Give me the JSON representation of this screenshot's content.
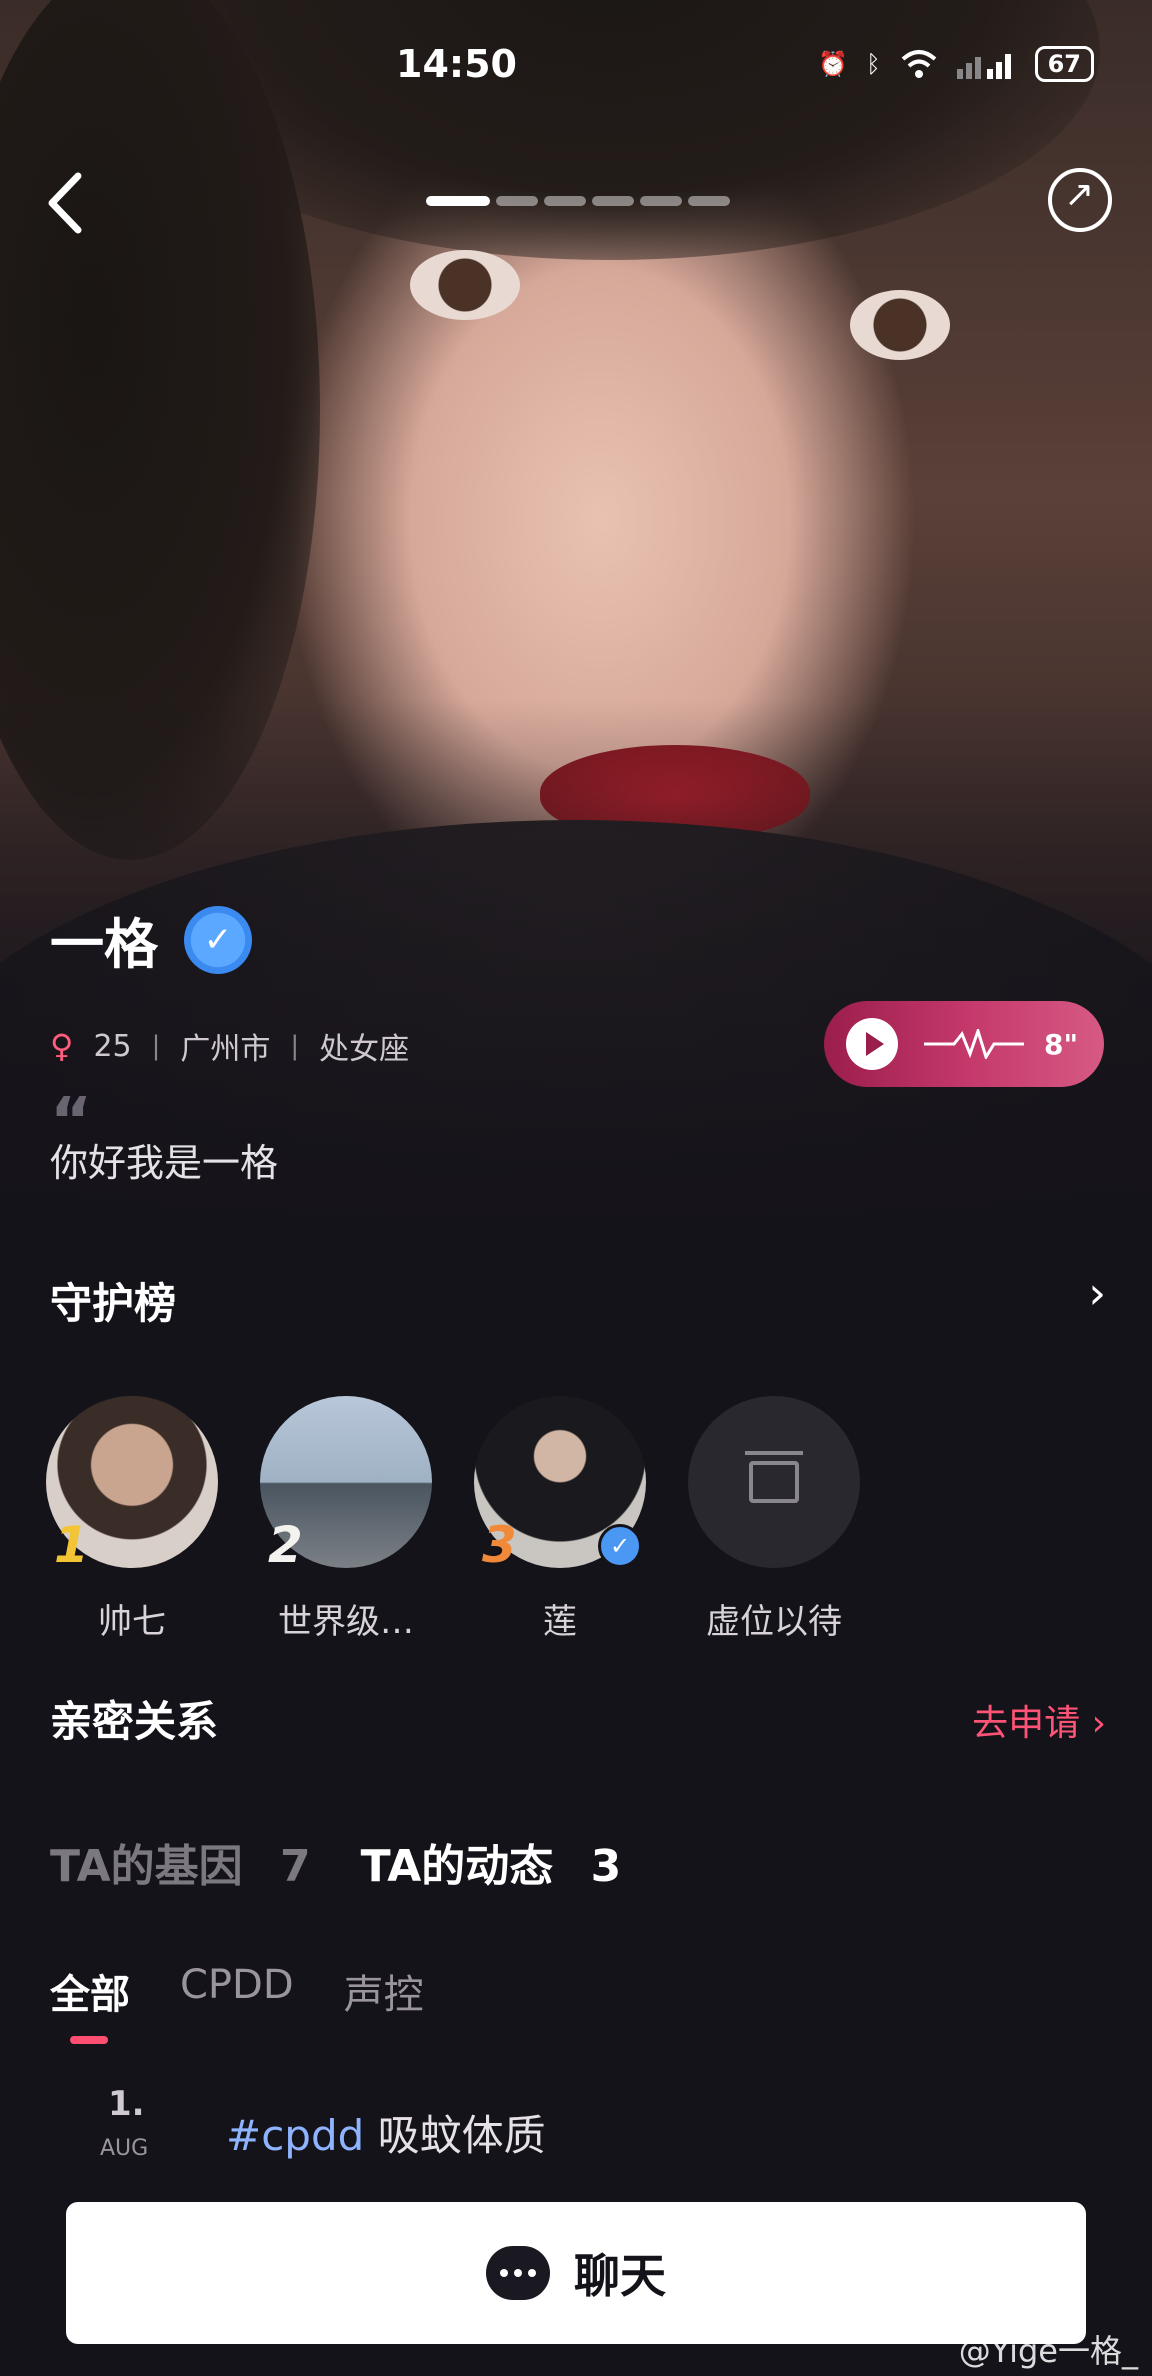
{
  "status_bar": {
    "time": "14:50",
    "icons": [
      "alarm-icon",
      "bluetooth-icon",
      "wifi-icon",
      "signal-icon"
    ],
    "battery": "67"
  },
  "profile": {
    "name": "一格",
    "age": "25",
    "city": "广州市",
    "zodiac": "处女座",
    "voice_duration": "8\"",
    "bio": "你好我是一格",
    "photo_count": 6,
    "current_photo": 1
  },
  "guardians": {
    "title": "守护榜",
    "items": [
      {
        "name": "帅七",
        "rank": "1"
      },
      {
        "name": "世界级…",
        "rank": "2"
      },
      {
        "name": "莲",
        "rank": "3"
      },
      {
        "name": "虚位以待",
        "rank": ""
      }
    ]
  },
  "intimacy": {
    "title": "亲密关系",
    "apply_label": "去申请"
  },
  "tabs": {
    "genes_label": "TA的基因",
    "genes_count": "7",
    "posts_label": "TA的动态",
    "posts_count": "3"
  },
  "sub_tabs": [
    "全部",
    "CPDD",
    "声控"
  ],
  "post": {
    "day": "1.",
    "month": "AUG",
    "tag": "#cpdd",
    "text": "吸蚊体质"
  },
  "chat_button": {
    "label": "聊天"
  },
  "watermark": "@Yige一格_",
  "colors": {
    "background": "#15131a",
    "accent": "#ff4f70",
    "verified": "#4b98f3",
    "voice_pill": "#c4376a"
  }
}
